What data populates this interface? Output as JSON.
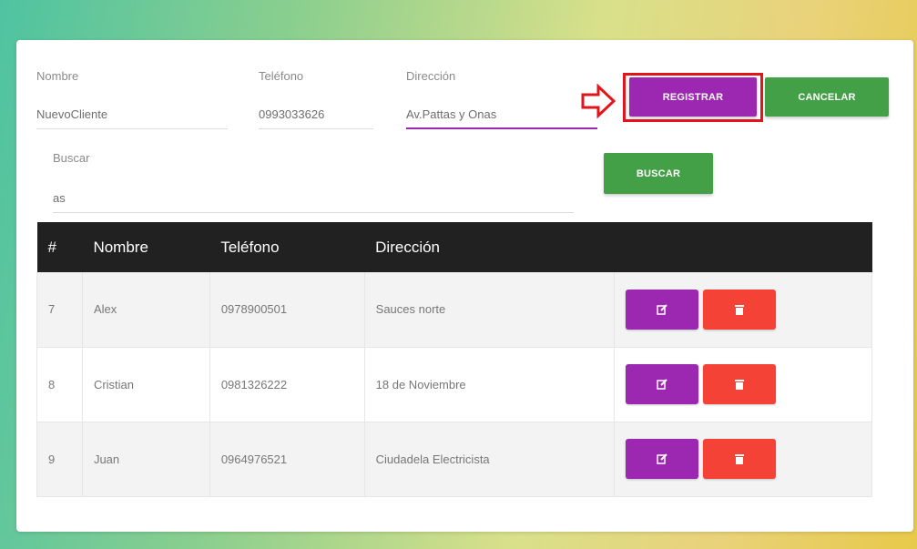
{
  "form": {
    "nombre": {
      "label": "Nombre",
      "value": "NuevoCliente"
    },
    "telefono": {
      "label": "Teléfono",
      "value": "0993033626"
    },
    "direccion": {
      "label": "Dirección",
      "value": "Av.Pattas y Onas"
    },
    "registrar_label": "REGISTRAR",
    "cancelar_label": "CANCELAR"
  },
  "search": {
    "label": "Buscar",
    "value": "as",
    "button_label": "BUSCAR"
  },
  "table": {
    "headers": [
      "#",
      "Nombre",
      "Teléfono",
      "Dirección",
      ""
    ],
    "rows": [
      {
        "id": "7",
        "nombre": "Alex",
        "telefono": "0978900501",
        "direccion": "Sauces norte"
      },
      {
        "id": "8",
        "nombre": "Cristian",
        "telefono": "0981326222",
        "direccion": "18 de Noviembre"
      },
      {
        "id": "9",
        "nombre": "Juan",
        "telefono": "0964976521",
        "direccion": "Ciudadela Electricista"
      }
    ]
  },
  "colors": {
    "primary": "#9c27b0",
    "success": "#43a047",
    "danger": "#f44336",
    "highlight": "#e3151b",
    "table_header": "#212121"
  },
  "icons": {
    "edit": "edit-icon",
    "delete": "trash-icon",
    "arrow": "arrow-right-icon"
  }
}
